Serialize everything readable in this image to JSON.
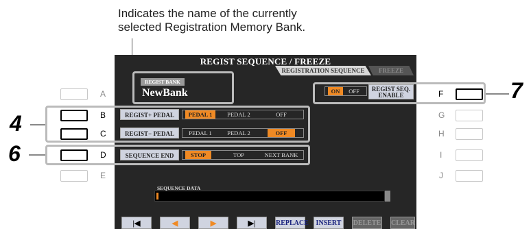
{
  "caption": {
    "line1": "Indicates the name of the currently",
    "line2": "selected Registration Memory Bank."
  },
  "screen": {
    "title": "REGIST SEQUENCE / FREEZE",
    "tabs": [
      {
        "label": "REGISTRATION SEQUENCE",
        "active": true
      },
      {
        "label": "FREEZE",
        "active": false
      }
    ],
    "bank_label": "REGIST BANK",
    "bank_name": "NewBank",
    "onoff": {
      "on": "ON",
      "off": "OFF",
      "selected": "ON"
    },
    "enable_button": {
      "line1": "REGIST SEQ.",
      "line2": "ENABLE"
    },
    "rows": [
      {
        "label": "REGIST+ PEDAL",
        "options": [
          "PEDAL 1",
          "PEDAL 2",
          "OFF"
        ],
        "selected": "PEDAL 1"
      },
      {
        "label": "REGIST− PEDAL",
        "options": [
          "PEDAL 1",
          "PEDAL 2",
          "OFF"
        ],
        "selected": "OFF"
      },
      {
        "label": "SEQUENCE END",
        "options": [
          "STOP",
          "TOP",
          "NEXT BANK"
        ],
        "selected": "STOP"
      }
    ],
    "sequence_data_label": "SEQUENCE DATA",
    "nav": [
      {
        "label": "|◀",
        "icon": "skip-to-start-icon"
      },
      {
        "label": "◀",
        "icon": "step-back-icon"
      },
      {
        "label": "▶",
        "icon": "step-forward-icon"
      },
      {
        "label": "▶|",
        "icon": "skip-to-end-icon"
      },
      {
        "label": "REPLACE"
      },
      {
        "label": "INSERT"
      },
      {
        "label": "DELETE",
        "disabled": true
      },
      {
        "label": "CLEAR",
        "disabled": true
      }
    ]
  },
  "left_buttons": [
    "A",
    "B",
    "C",
    "D",
    "E"
  ],
  "right_buttons": [
    "F",
    "G",
    "H",
    "I",
    "J"
  ],
  "callouts": {
    "rows_bc": "4",
    "row_d": "6",
    "enable": "7"
  },
  "colors": {
    "accent": "#f08a24",
    "screen_bg": "#262626",
    "button_face": "#d0d4e0"
  }
}
